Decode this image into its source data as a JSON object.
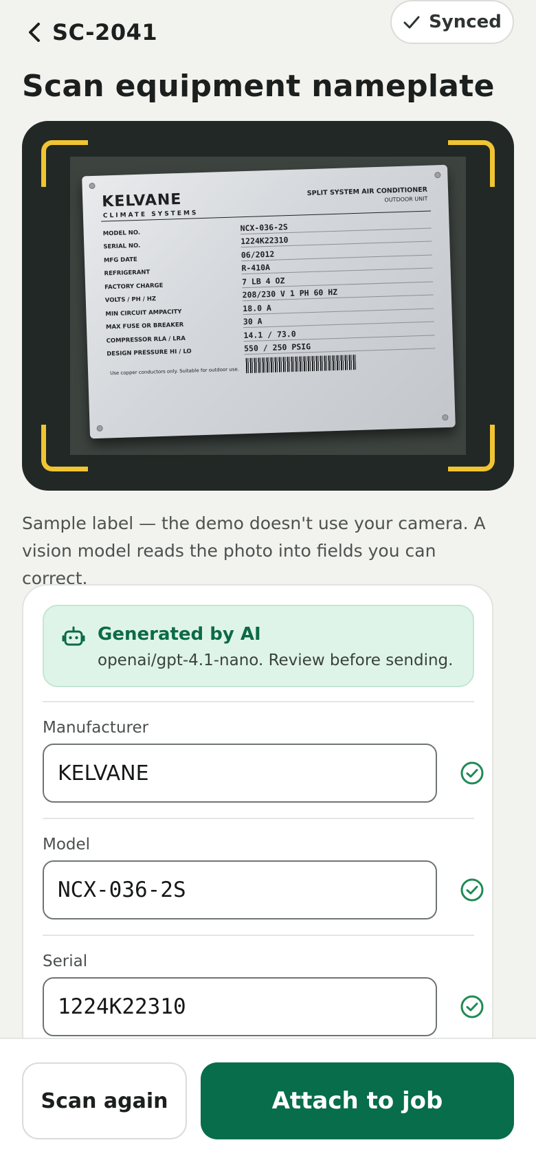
{
  "header": {
    "job_id": "SC-2041",
    "sync_status": "Synced",
    "title": "Scan equipment nameplate"
  },
  "nameplate": {
    "brand": "KELVANE",
    "brand_sub": "CLIMATE SYSTEMS",
    "unit_type": "SPLIT SYSTEM AIR CONDITIONER",
    "unit_sub": "OUTDOOR UNIT",
    "rows": [
      {
        "label": "MODEL NO.",
        "value": "NCX-036-2S"
      },
      {
        "label": "SERIAL NO.",
        "value": "1224K22310"
      },
      {
        "label": "MFG DATE",
        "value": "06/2012"
      },
      {
        "label": "REFRIGERANT",
        "value": "R-410A"
      },
      {
        "label": "FACTORY CHARGE",
        "value": "7 LB 4 OZ"
      },
      {
        "label": "VOLTS / PH / HZ",
        "value": "208/230 V 1 PH 60 HZ"
      },
      {
        "label": "MIN CIRCUIT AMPACITY",
        "value": "18.0 A"
      },
      {
        "label": "MAX FUSE OR BREAKER",
        "value": "30 A"
      },
      {
        "label": "COMPRESSOR RLA / LRA",
        "value": "14.1 / 73.0"
      },
      {
        "label": "DESIGN PRESSURE HI / LO",
        "value": "550 / 250 PSIG"
      }
    ],
    "note": "Use copper conductors only. Suitable for outdoor use."
  },
  "caption": "Sample label — the demo doesn't use your camera. A vision model reads the photo into fields you can correct.",
  "ai_notice": {
    "title": "Generated by AI",
    "subtitle": "openai/gpt-4.1-nano. Review before sending."
  },
  "fields": {
    "manufacturer": {
      "label": "Manufacturer",
      "value": "KELVANE"
    },
    "model": {
      "label": "Model",
      "value": "NCX-036-2S"
    },
    "serial": {
      "label": "Serial",
      "value": "1224K22310"
    }
  },
  "actions": {
    "scan_again": "Scan again",
    "attach": "Attach to job"
  },
  "colors": {
    "accent": "#076d4a",
    "ai_bg": "#dff4e8",
    "viewfinder": "#f1c531",
    "check": "#1f8a55"
  }
}
